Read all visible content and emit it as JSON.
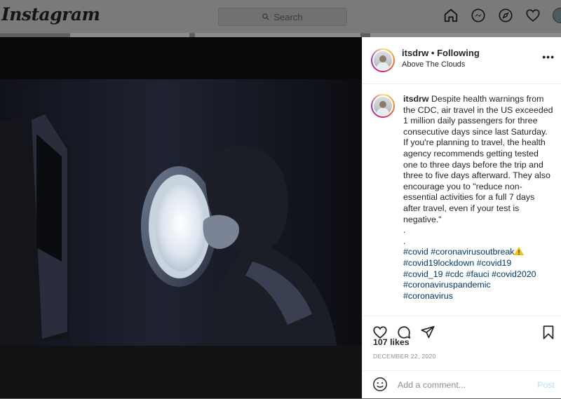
{
  "nav": {
    "logo": "Instagram",
    "search_placeholder": "Search",
    "icons": [
      "home-icon",
      "messenger-icon",
      "explore-icon",
      "heart-icon",
      "profile-avatar"
    ]
  },
  "post": {
    "username": "itsdrw",
    "follow_separator": "•",
    "follow_status": "Following",
    "location": "Above The Clouds",
    "more": "•••",
    "caption_user": "itsdrw",
    "caption_text": "Despite health warnings from the CDC, air travel in the US exceeded 1 million daily passengers for three consecutive days since last Saturday. If you're planning to travel, the health agency recommends getting tested one to three days before the trip and three to five days afterward. They also encourage you to \"reduce non-essential activities for a full 7 days after travel, even if your test is negative.\"",
    "caption_dots": [
      ".",
      "."
    ],
    "hashtags": [
      [
        "#covid",
        "#coronavirusoutbreak"
      ],
      [
        "#covid19lockdown",
        "#covid19"
      ],
      [
        "#covid_19",
        "#cdc",
        "#fauci",
        "#covid2020"
      ],
      [
        "#coronaviruspandemic"
      ],
      [
        "#coronavirus"
      ]
    ],
    "likes": "107 likes",
    "date": "DECEMBER 22, 2020",
    "comment_placeholder": "Add a comment...",
    "post_label": "Post"
  },
  "colors": {
    "link": "#00376b",
    "post_disabled": "#b2dffc",
    "overlay": "#5e5e5e"
  }
}
